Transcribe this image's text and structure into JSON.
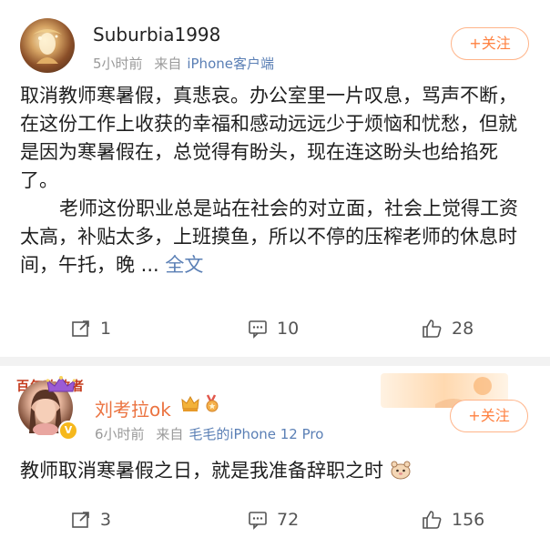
{
  "posts": [
    {
      "username": "Suburbia1998",
      "time": "5小时前",
      "source_prefix": "来自",
      "source": "iPhone客户端",
      "follow_label": "+关注",
      "paragraphs": [
        "取消教师寒暑假，真悲哀。办公室里一片叹息，骂声不断，在这份工作上收获的幸福和感动远远少于烦恼和忧愁，但就是因为寒暑假在，总觉得有盼头，现在连这盼头也给掐死了。",
        "老师这份职业总是站在社会的对立面，社会上觉得工资太高，补贴太多，上班摸鱼，所以不停的压榨老师的休息时间，午托，晚 ..."
      ],
      "full_text_label": "全文",
      "repost_count": "1",
      "comment_count": "10",
      "like_count": "28"
    },
    {
      "username": "刘考拉ok",
      "time": "6小时前",
      "source_prefix": "来自",
      "source": "毛毛的iPhone 12 Pro",
      "follow_label": "+关注",
      "banner_text": "百年致敬者",
      "text": "教师取消寒暑假之日，就是我准备辞职之时",
      "repost_count": "3",
      "comment_count": "72",
      "like_count": "156"
    }
  ],
  "colors": {
    "accent_orange": "#ff8140",
    "link_blue": "#5a7fb5",
    "vip_name": "#eb7340",
    "meta_gray": "#9a9a9a"
  }
}
